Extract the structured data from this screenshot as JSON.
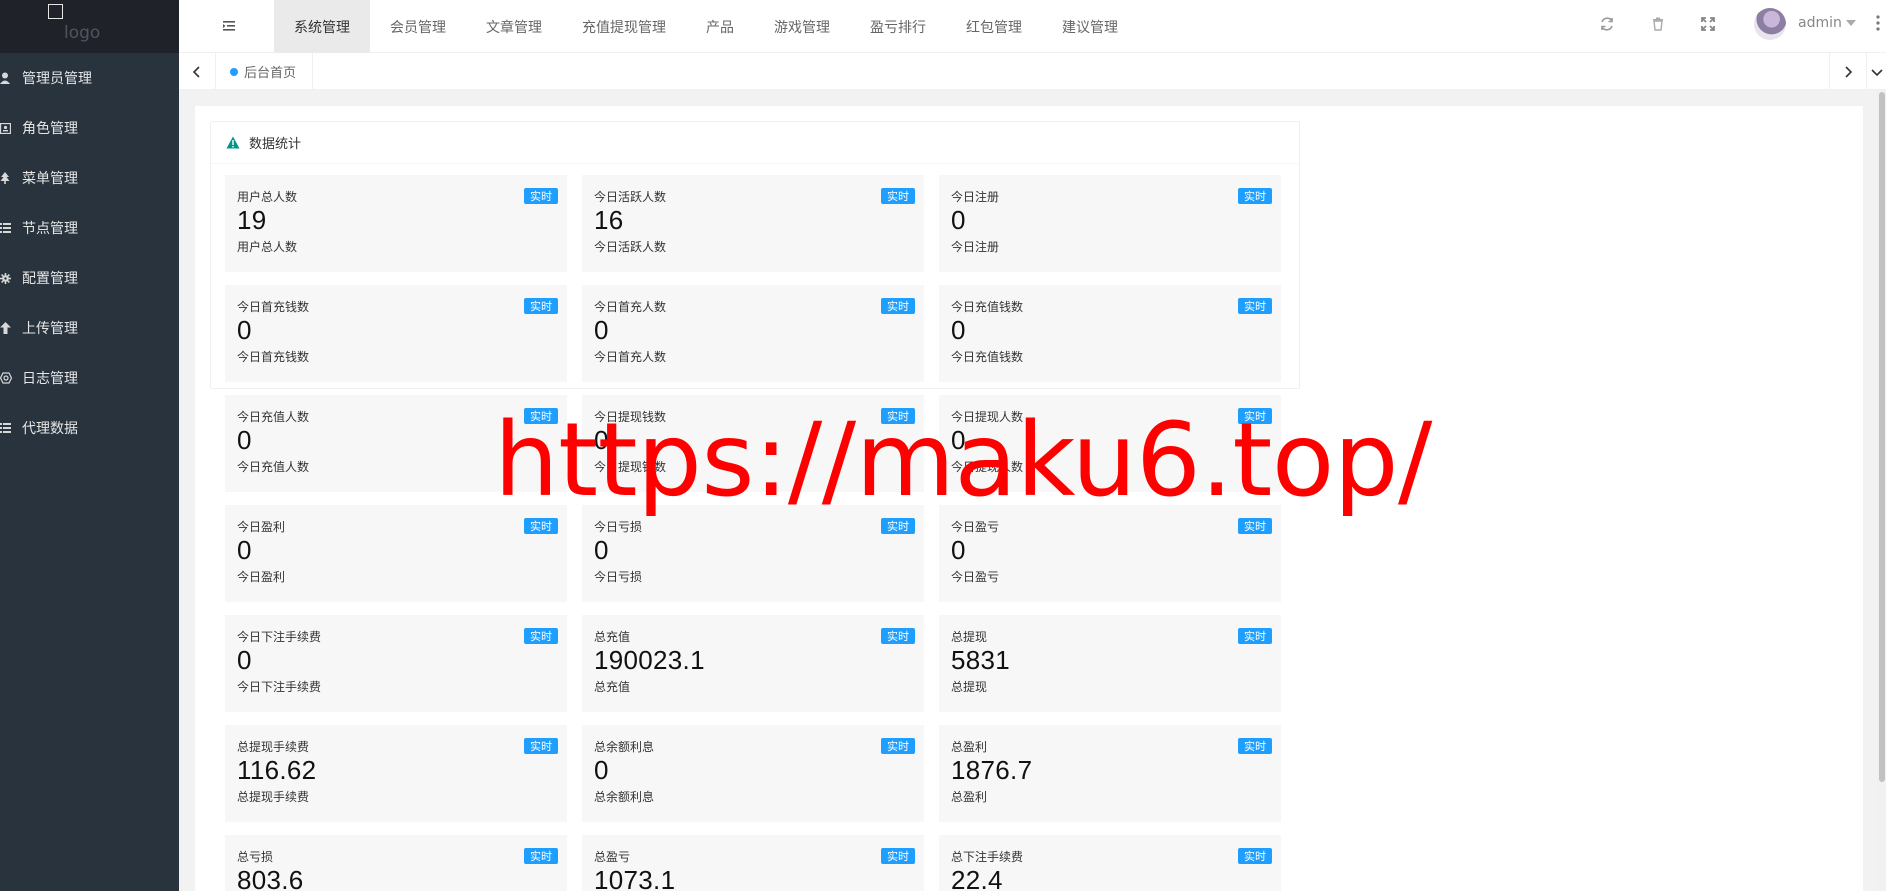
{
  "sidebar": {
    "logo": "logo",
    "items": [
      {
        "label": "管理员管理",
        "icon": "user-icon"
      },
      {
        "label": "角色管理",
        "icon": "role-icon"
      },
      {
        "label": "菜单管理",
        "icon": "tree-icon"
      },
      {
        "label": "节点管理",
        "icon": "list-icon"
      },
      {
        "label": "配置管理",
        "icon": "gear-icon"
      },
      {
        "label": "上传管理",
        "icon": "upload-icon"
      },
      {
        "label": "日志管理",
        "icon": "log-icon"
      },
      {
        "label": "代理数据",
        "icon": "list-icon"
      }
    ]
  },
  "header": {
    "tabs": [
      "系统管理",
      "会员管理",
      "文章管理",
      "充值提现管理",
      "产品",
      "游戏管理",
      "盈亏排行",
      "红包管理",
      "建议管理"
    ],
    "active_tab": "系统管理",
    "username": "admin"
  },
  "tabbar": {
    "home_label": "后台首页"
  },
  "panel": {
    "title": "数据统计"
  },
  "badge_label": "实时",
  "cards": [
    {
      "title": "用户总人数",
      "value": "19",
      "sub": "用户总人数"
    },
    {
      "title": "今日活跃人数",
      "value": "16",
      "sub": "今日活跃人数"
    },
    {
      "title": "今日注册",
      "value": "0",
      "sub": "今日注册"
    },
    {
      "title": "今日首充钱数",
      "value": "0",
      "sub": "今日首充钱数"
    },
    {
      "title": "今日首充人数",
      "value": "0",
      "sub": "今日首充人数"
    },
    {
      "title": "今日充值钱数",
      "value": "0",
      "sub": "今日充值钱数"
    },
    {
      "title": "今日充值人数",
      "value": "0",
      "sub": "今日充值人数"
    },
    {
      "title": "今日提现钱数",
      "value": "0",
      "sub": "今日提现钱数"
    },
    {
      "title": "今日提现人数",
      "value": "0",
      "sub": "今日提现人数"
    },
    {
      "title": "今日盈利",
      "value": "0",
      "sub": "今日盈利"
    },
    {
      "title": "今日亏损",
      "value": "0",
      "sub": "今日亏损"
    },
    {
      "title": "今日盈亏",
      "value": "0",
      "sub": "今日盈亏"
    },
    {
      "title": "今日下注手续费",
      "value": "0",
      "sub": "今日下注手续费"
    },
    {
      "title": "总充值",
      "value": "190023.1",
      "sub": "总充值"
    },
    {
      "title": "总提现",
      "value": "5831",
      "sub": "总提现"
    },
    {
      "title": "总提现手续费",
      "value": "116.62",
      "sub": "总提现手续费"
    },
    {
      "title": "总余额利息",
      "value": "0",
      "sub": "总余额利息"
    },
    {
      "title": "总盈利",
      "value": "1876.7",
      "sub": "总盈利"
    },
    {
      "title": "总亏损",
      "value": "803.6",
      "sub": ""
    },
    {
      "title": "总盈亏",
      "value": "1073.1",
      "sub": ""
    },
    {
      "title": "总下注手续费",
      "value": "22.4",
      "sub": ""
    }
  ],
  "watermark": "https://maku6.top/",
  "colors": {
    "sidebar_bg": "#28333e",
    "badge": "#1e9fff",
    "watermark": "#ff0000"
  }
}
